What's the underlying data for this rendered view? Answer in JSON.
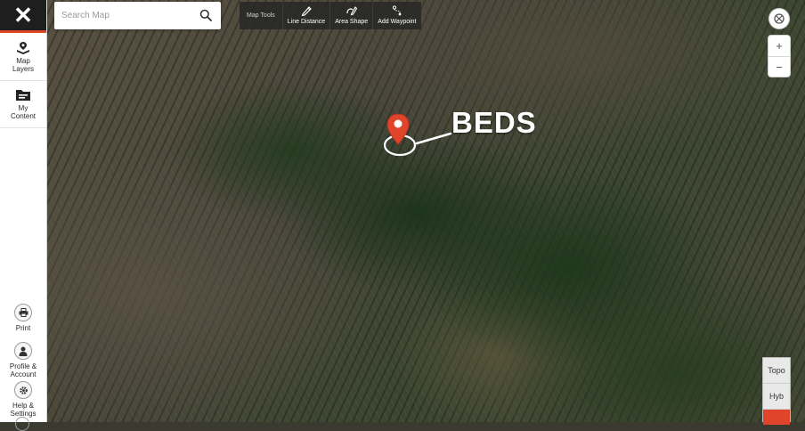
{
  "sidebar": {
    "close_label": "✕",
    "items_top": [
      {
        "label_line1": "Map",
        "label_line2": "Layers",
        "icon": "map-layers-icon"
      },
      {
        "label_line1": "My",
        "label_line2": "Content",
        "icon": "folder-icon"
      }
    ],
    "items_bottom": [
      {
        "label_line1": "Print",
        "label_line2": "",
        "icon": "printer-icon"
      },
      {
        "label_line1": "Profile &",
        "label_line2": "Account",
        "icon": "person-icon"
      },
      {
        "label_line1": "Help &",
        "label_line2": "Settings",
        "icon": "gear-icon"
      }
    ]
  },
  "search": {
    "placeholder": "Search Map",
    "value": ""
  },
  "toolbar": {
    "title": "Map Tools",
    "tools": [
      {
        "label": "Line Distance",
        "icon": "ruler-pencil-icon"
      },
      {
        "label": "Area Shape",
        "icon": "area-shape-icon"
      },
      {
        "label": "Add Waypoint",
        "icon": "waypoint-route-icon"
      }
    ]
  },
  "controls": {
    "locate_icon": "crosshair-icon",
    "zoom_in": "+",
    "zoom_out": "−"
  },
  "layers": [
    {
      "label": "Topo",
      "active": false
    },
    {
      "label": "Hyb",
      "active": false
    },
    {
      "label": "",
      "active": true
    }
  ],
  "annotation": {
    "text": "BEDS",
    "marker_color": "#e0442b"
  },
  "colors": {
    "accent": "#e0442b",
    "sidebar_dark": "#1e1e1e"
  }
}
